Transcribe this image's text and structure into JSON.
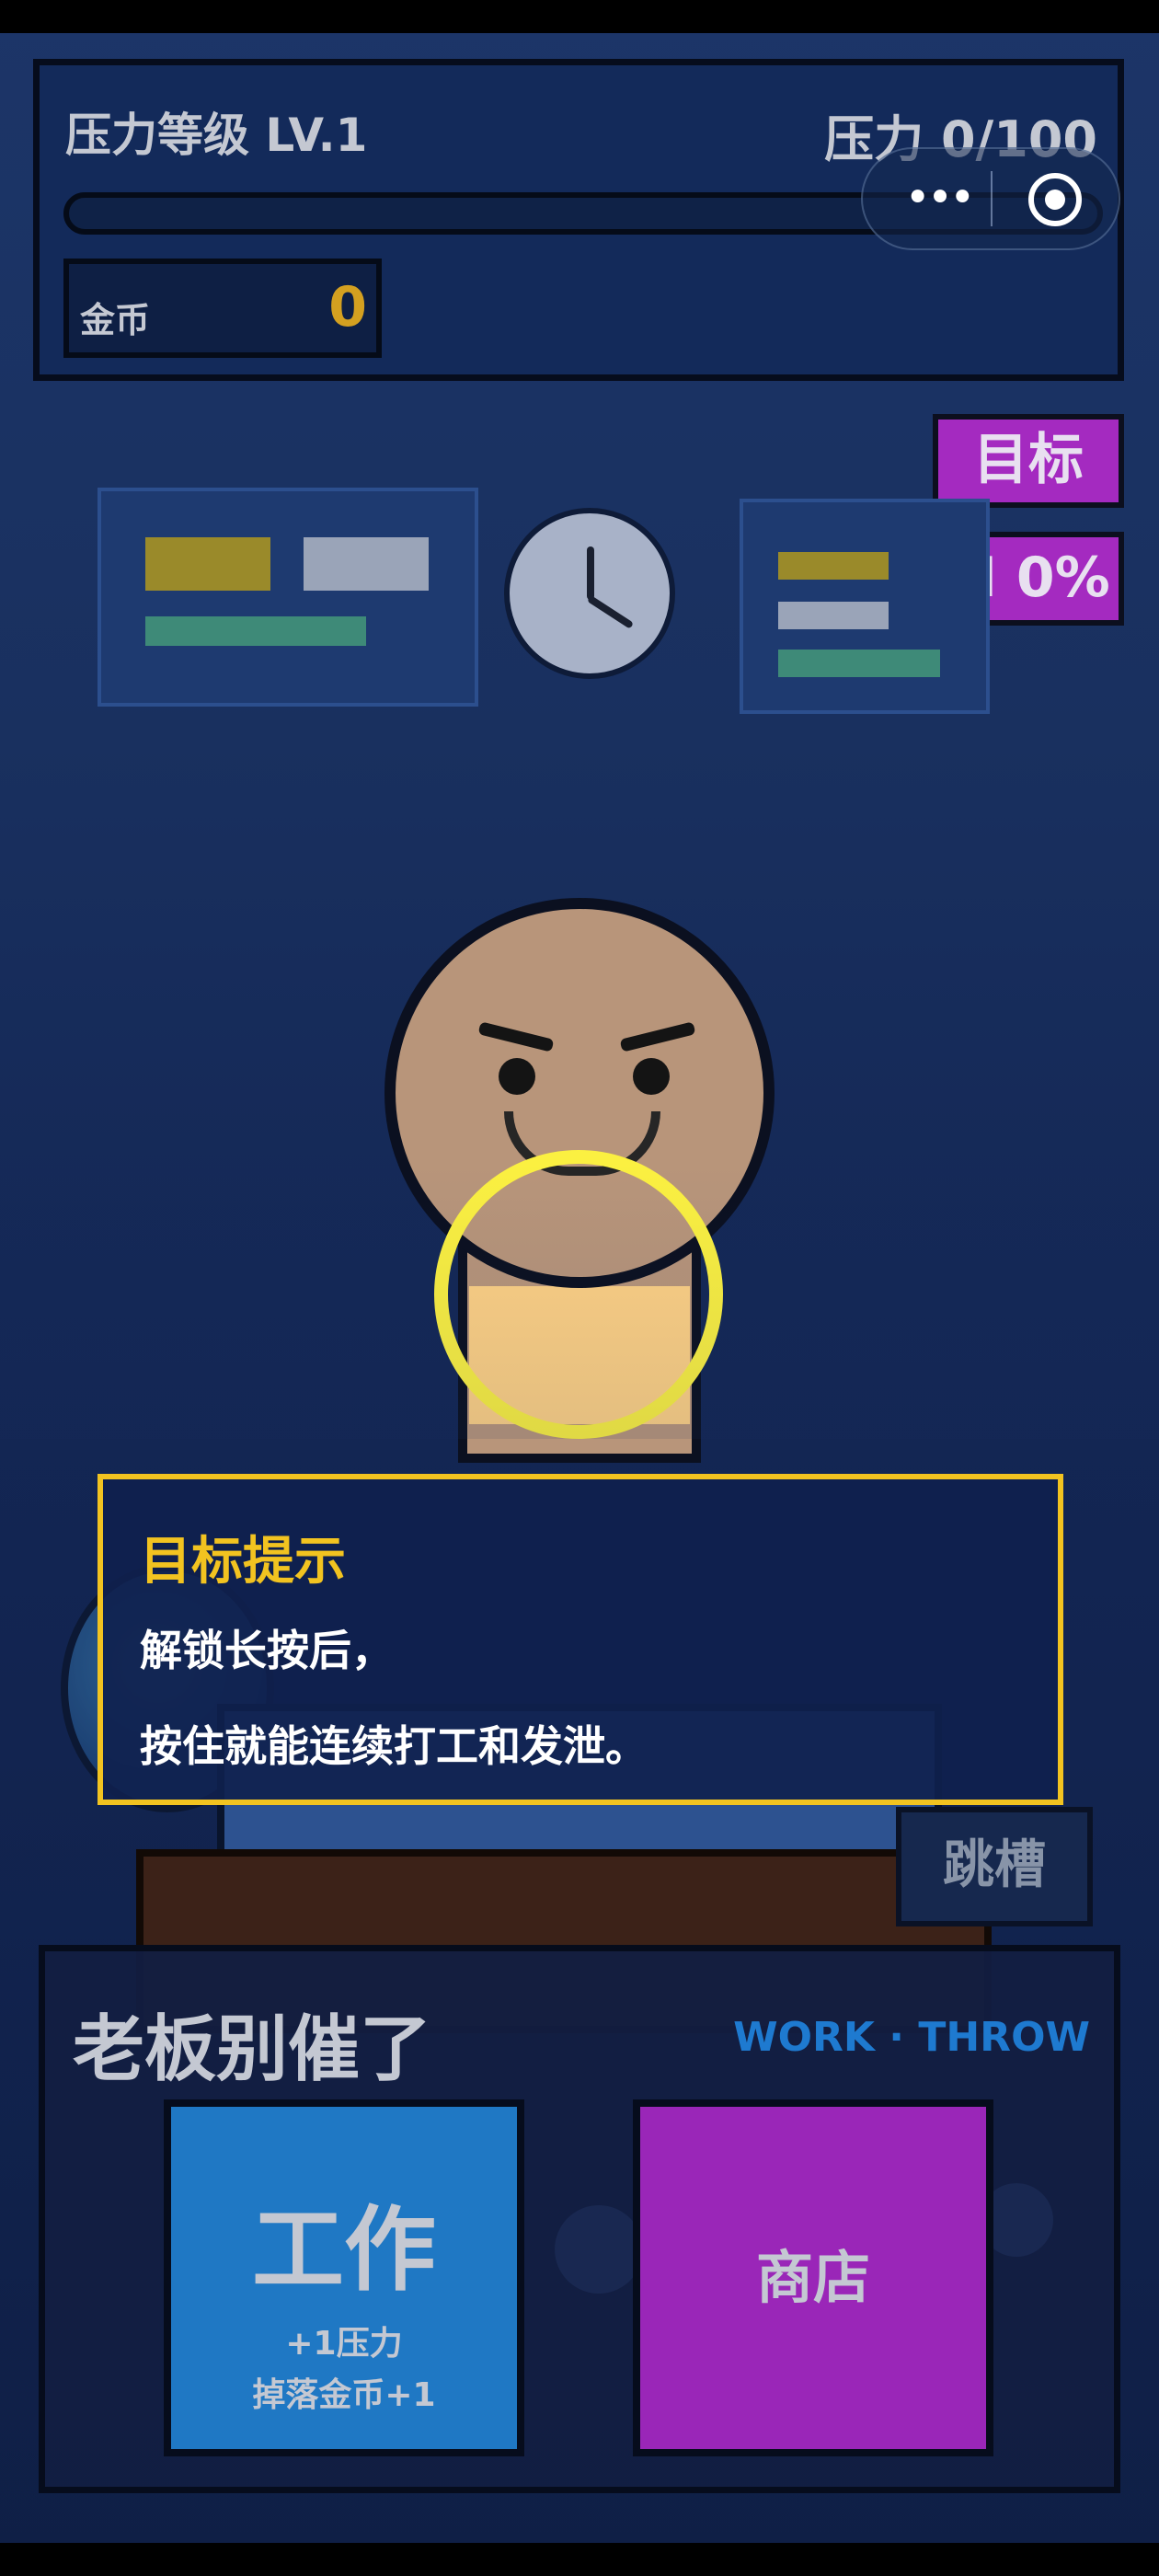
{
  "hud": {
    "level_label": "压力等级 LV.1",
    "stress_label": "压力 0/100",
    "stress_value": 0,
    "stress_max": 100,
    "coins_label": "金币",
    "coins_value": "0"
  },
  "tags": {
    "goal": "目标",
    "kpi": "KPI 0%"
  },
  "tooltip": {
    "title": "目标提示",
    "line1": "解锁长按后，",
    "line2": "按住就能连续打工和发泄。"
  },
  "jump_label": "跳槽",
  "panel": {
    "title": "老板别催了",
    "subtitle": "WORK · THROW",
    "work_button": {
      "label": "工作",
      "line1": "+1压力",
      "line2": "掉落金币+1"
    },
    "shop_button": {
      "label": "商店"
    }
  },
  "capsule": {
    "more_icon": "•••",
    "icons": [
      "more-icon",
      "target-icon"
    ]
  },
  "colors": {
    "accent_yellow": "#f2c320",
    "work_blue": "#1f78c4",
    "shop_purple": "#9a26b8",
    "coin_gold": "#d4a020"
  }
}
